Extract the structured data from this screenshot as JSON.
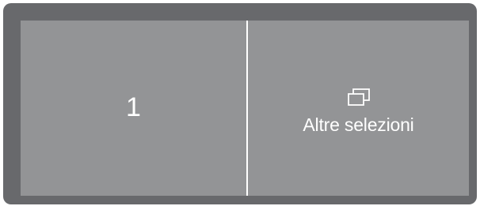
{
  "left_option": {
    "label": "1"
  },
  "right_option": {
    "icon": "windows-stack-icon",
    "label": "Altre selezioni"
  },
  "colors": {
    "frame": "#68696c",
    "panel": "#939496",
    "text": "#ffffff"
  }
}
